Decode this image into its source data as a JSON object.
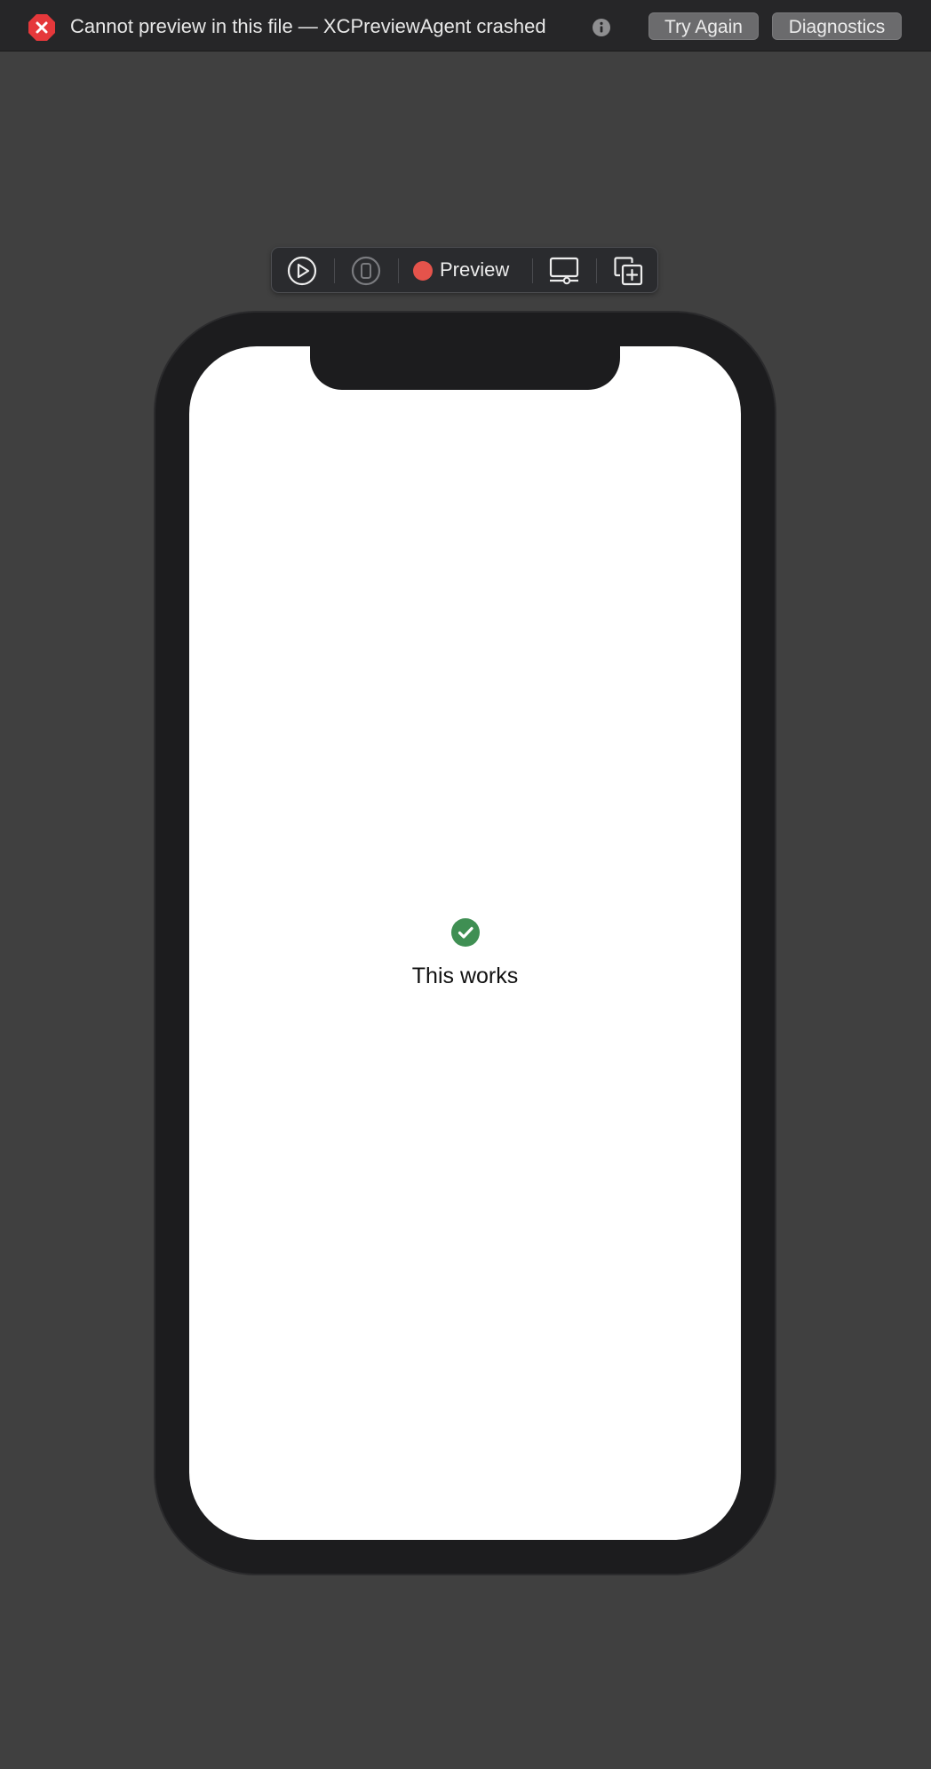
{
  "banner": {
    "message": "Cannot preview in this file — XCPreviewAgent crashed",
    "try_again_label": "Try Again",
    "diagnostics_label": "Diagnostics",
    "error_icon": "error-x-icon",
    "info_icon": "info-icon"
  },
  "toolbar": {
    "live_preview_icon": "play-icon",
    "device_icon": "device-icon",
    "preview_label": "Preview",
    "preview_status_color": "#e5534b",
    "settings_icon": "device-settings-icon",
    "duplicate_icon": "duplicate-plus-icon"
  },
  "screen": {
    "status_icon": "checkmark-circle-icon",
    "status_color": "#3f8f53",
    "label": "This works"
  },
  "colors": {
    "background": "#404040",
    "banner": "#262628",
    "error_red": "#e5383b",
    "device_frame": "#1c1c1e"
  }
}
